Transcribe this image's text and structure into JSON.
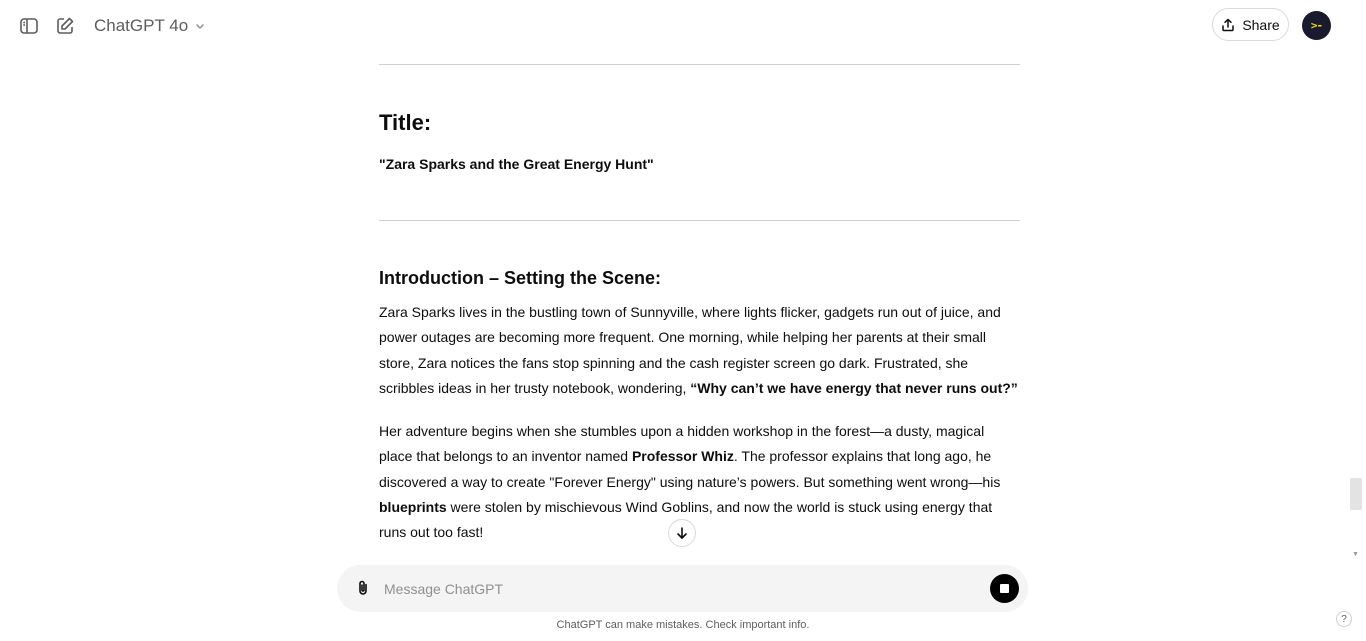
{
  "header": {
    "model_name": "ChatGPT 4o",
    "share_label": "Share",
    "avatar_text": ">-"
  },
  "content": {
    "title_heading": "Title:",
    "story_title": "\"Zara Sparks and the Great Energy Hunt\"",
    "intro_heading": "Introduction – Setting the Scene:",
    "para1": {
      "text_before": "Zara Sparks lives in the bustling town of Sunnyville, where lights flicker, gadgets run out of juice, and power outages are becoming more frequent. One morning, while helping her parents at their small store, Zara notices the fans stop spinning and the cash register screen go dark. Frustrated, she scribbles ideas in her trusty notebook, wondering, ",
      "quote_bold": "“Why can’t we have energy that never runs out?”"
    },
    "para2": {
      "part1": "Her adventure begins when she stumbles upon a hidden workshop in the forest—a dusty, magical place that belongs to an inventor named ",
      "bold1": "Professor Whiz",
      "part2": ". The professor explains that long ago, he discovered a way to create \"Forever Energy\" using nature’s powers. But something went wrong—his ",
      "bold2": "blueprints",
      "part3": " were stolen by mischievous Wind Goblins, and now the world is stuck using energy that runs out too fast!"
    }
  },
  "composer": {
    "placeholder": "Message ChatGPT"
  },
  "footer": {
    "disclaimer": "ChatGPT can make mistakes. Check important info."
  },
  "help_label": "?"
}
